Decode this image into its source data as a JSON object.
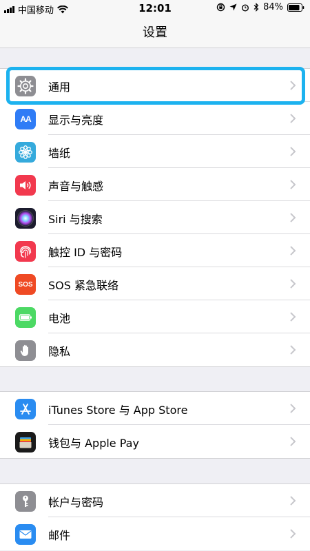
{
  "status": {
    "carrier": "中国移动",
    "time": "12:01",
    "battery": "84%"
  },
  "nav": {
    "title": "设置"
  },
  "groups": [
    {
      "items": [
        {
          "label": "通用",
          "icon": "gear-icon",
          "color": "#8e8e93"
        },
        {
          "label": "显示与亮度",
          "icon": "display-brightness-icon",
          "color": "#2f7cf6"
        },
        {
          "label": "墙纸",
          "icon": "wallpaper-flower-icon",
          "color": "#35aadc"
        },
        {
          "label": "声音与触感",
          "icon": "speaker-icon",
          "color": "#f2394e"
        },
        {
          "label": "Siri 与搜索",
          "icon": "siri-icon",
          "color": "#1c1c2e"
        },
        {
          "label": "触控 ID 与密码",
          "icon": "fingerprint-icon",
          "color": "#f2394e"
        },
        {
          "label": "SOS 紧急联络",
          "icon": "sos-icon",
          "color": "#ef4a24"
        },
        {
          "label": "电池",
          "icon": "battery-icon",
          "color": "#4cd964"
        },
        {
          "label": "隐私",
          "icon": "hand-icon",
          "color": "#8e8e93"
        }
      ]
    },
    {
      "items": [
        {
          "label": "iTunes Store 与 App Store",
          "icon": "app-store-icon",
          "color": "#2a8cf1"
        },
        {
          "label": "钱包与 Apple Pay",
          "icon": "wallet-icon",
          "color": "#1a1a1a"
        }
      ]
    },
    {
      "items": [
        {
          "label": "帐户与密码",
          "icon": "key-icon",
          "color": "#8e8e93"
        },
        {
          "label": "邮件",
          "icon": "mail-icon",
          "color": "#2a8cf1"
        }
      ]
    }
  ],
  "icon_text": {
    "display": "AA",
    "sos": "SOS"
  }
}
